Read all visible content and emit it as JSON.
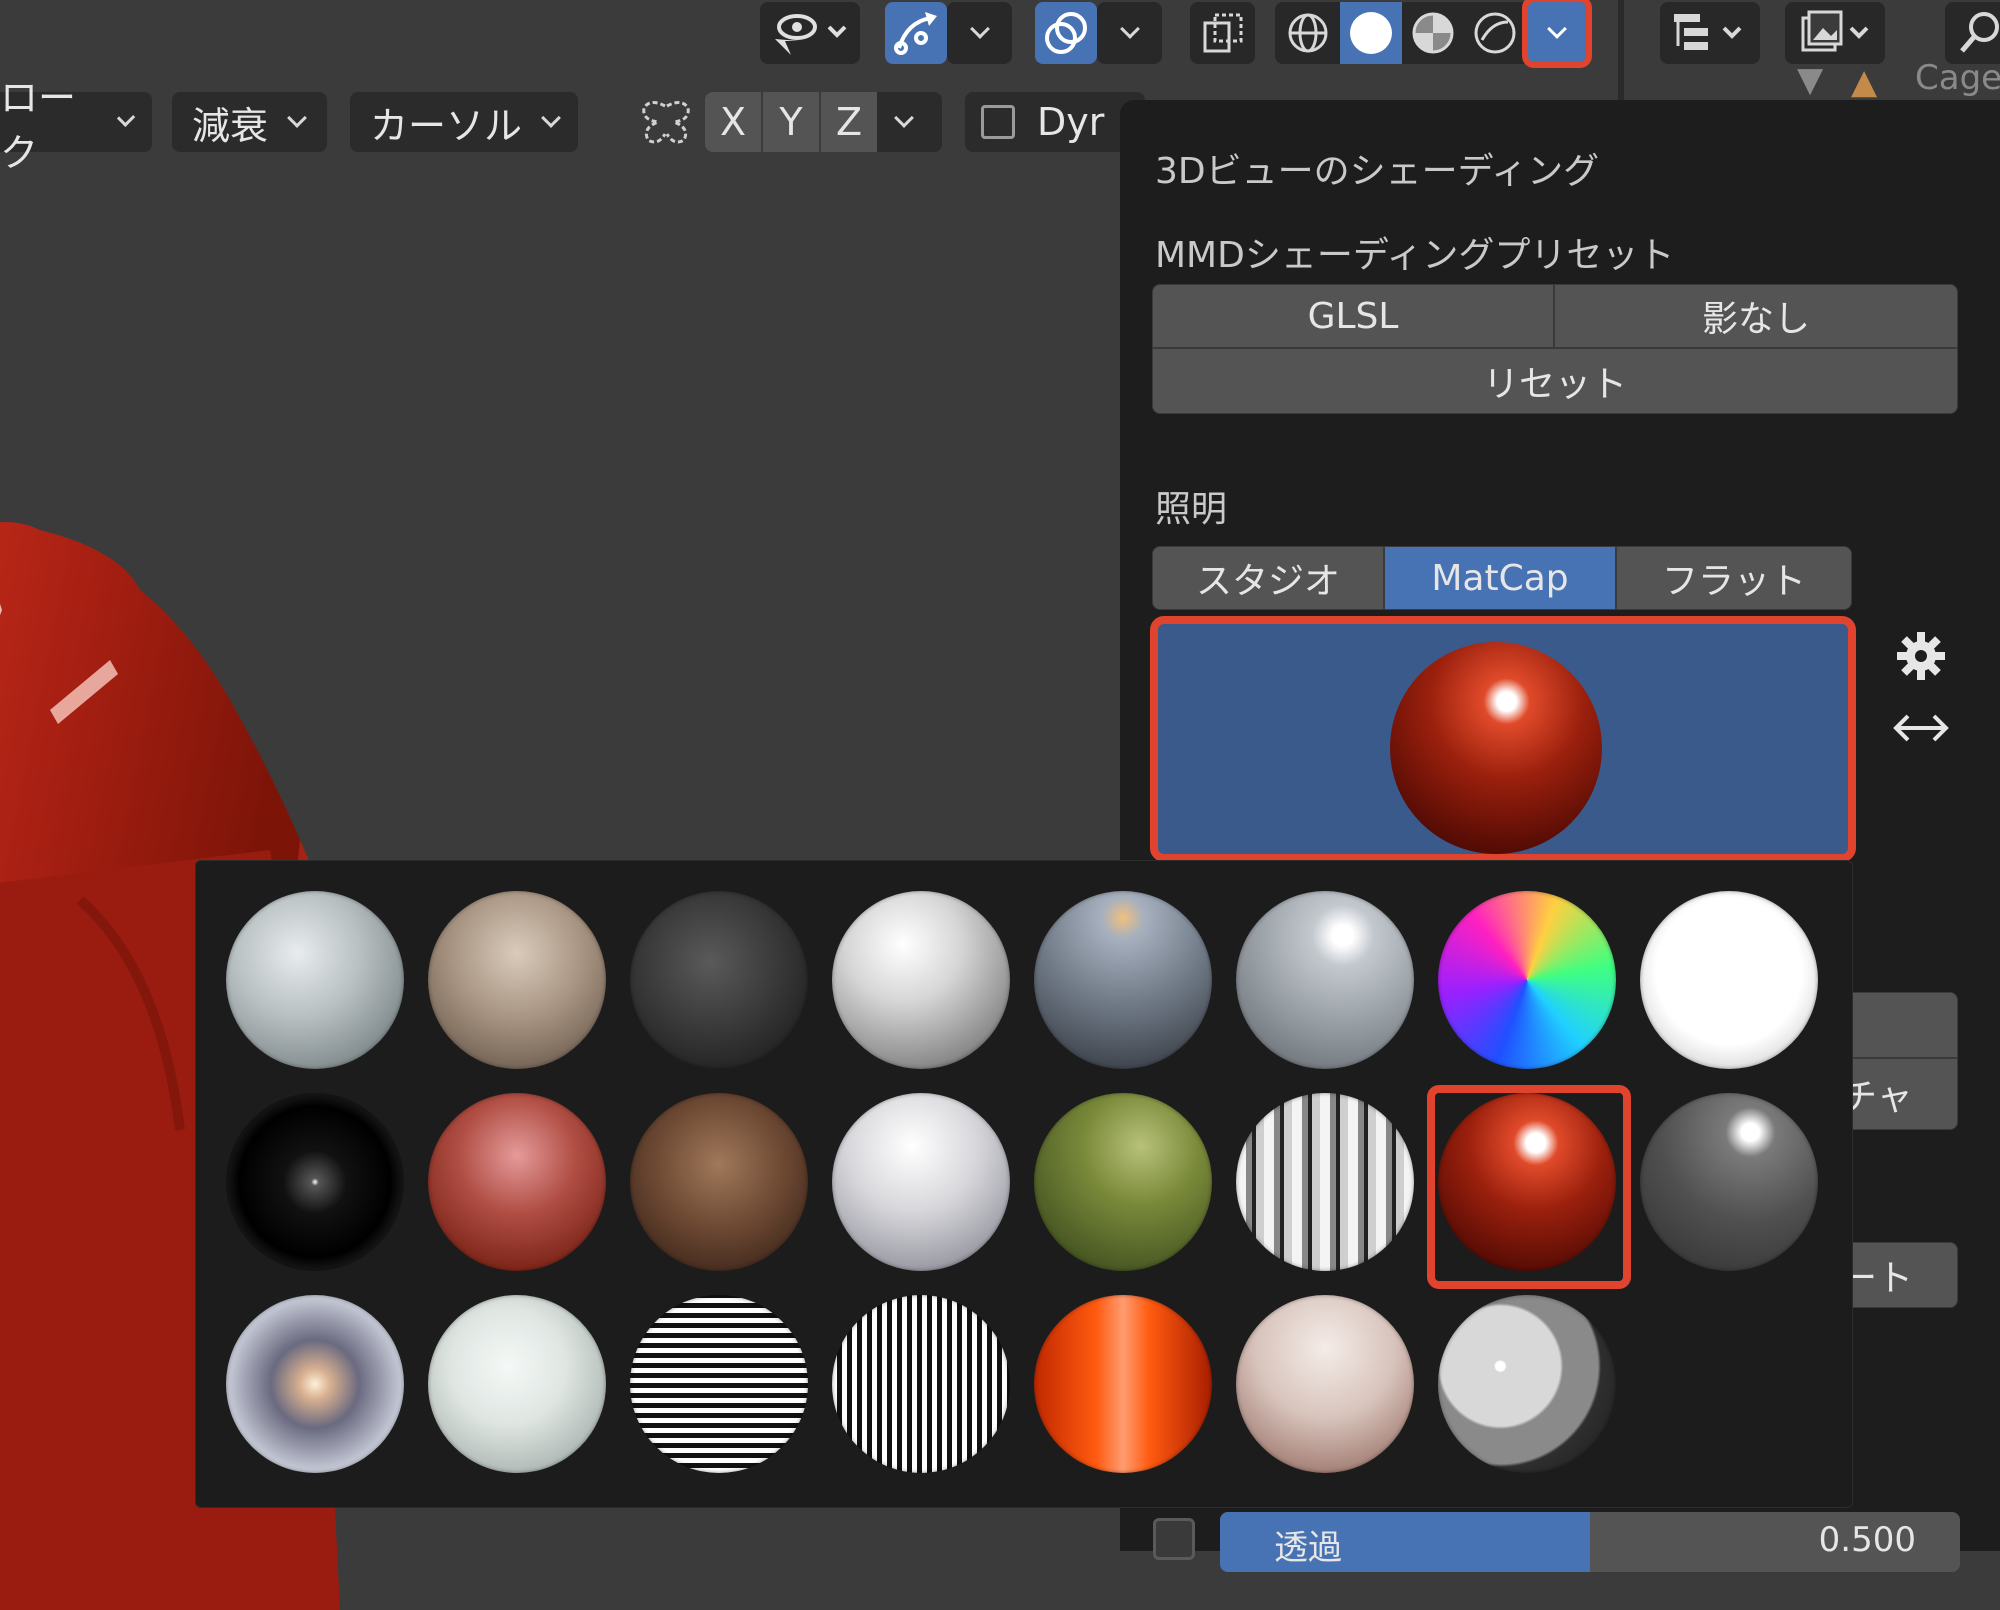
{
  "header": {
    "axes": [
      "X",
      "Y",
      "Z"
    ],
    "dropdowns": [
      "ローク",
      "減衰",
      "カーソル"
    ],
    "dyn_label": "Dyr",
    "cage_label": "Cage"
  },
  "panel": {
    "title": "3Dビューのシェーディング",
    "mmd_preset_label": "MMDシェーディングプリセット",
    "mmd_buttons": [
      "GLSL",
      "影なし",
      "リセット"
    ],
    "lighting_label": "照明",
    "lighting_tabs": [
      "スタジオ",
      "MatCap",
      "フラット"
    ],
    "lighting_selected": "MatCap",
    "partial_labels": [
      "チャ",
      "ート"
    ],
    "transparency_label": "透過",
    "transparency_value": "0.500",
    "transparency_fraction": 0.5
  },
  "matcaps": {
    "selected_index": 14,
    "names": [
      "matcap-basic-1",
      "matcap-basic-2",
      "matcap-basic-dark",
      "matcap-basic-side",
      "matcap-ceramic-dark",
      "matcap-ceramic-lightbulb",
      "matcap-check-normal",
      "matcap-check-rim-light",
      "matcap-jade",
      "matcap-metal-carpaint",
      "matcap-metal-bronze",
      "matcap-metal-anisotropic",
      "matcap-metal-lead",
      "matcap-metal-shiny",
      "matcap-pearl",
      "matcap-reflection-check",
      "matcap-reflection-check-horizontal",
      "matcap-resin",
      "matcap-skin",
      "matcap-toon",
      "matcap-stripes-horizontal",
      "matcap-stripes-vertical",
      "matcap-orange",
      "matcap-clay"
    ]
  },
  "colors": {
    "accent": "#4772b3",
    "highlight": "#e0442f",
    "panel": "#1d1d1d",
    "viewport": "#3b3b3b"
  },
  "icons": {
    "visibility": "eye-pointer-icon",
    "gizmo": "gizmo-arrow-icon",
    "overlay": "overlay-circles-icon",
    "xray": "xray-toggle-icon",
    "shading_modes": [
      "wireframe-icon",
      "solid-icon",
      "material-preview-icon",
      "rendered-icon"
    ],
    "mirror": "butterfly-mirror-icon",
    "settings": "gear-icon",
    "swap": "horizontal-arrows-icon",
    "search": "search-icon"
  }
}
